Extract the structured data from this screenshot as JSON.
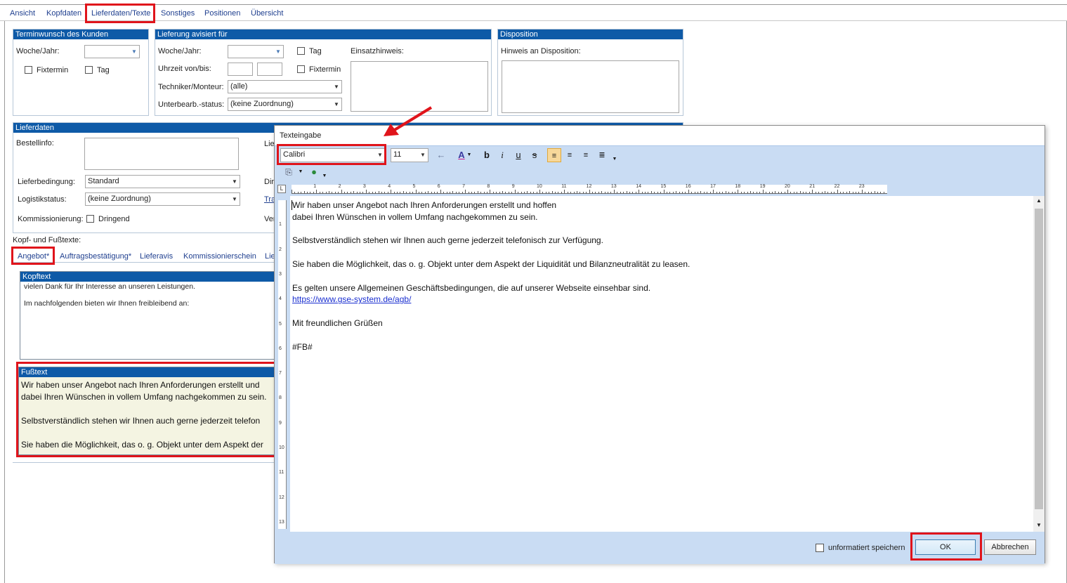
{
  "tabs": [
    "Ansicht",
    "Kopfdaten",
    "Lieferdaten/Texte",
    "Sonstiges",
    "Positionen",
    "Übersicht"
  ],
  "termin": {
    "header": "Terminwunsch des Kunden",
    "woche_label": "Woche/Jahr:",
    "fixtermin": "Fixtermin",
    "tag": "Tag"
  },
  "lieferung": {
    "header": "Lieferung avisiert für",
    "woche_label": "Woche/Jahr:",
    "tag": "Tag",
    "einsatz_label": "Einsatzhinweis:",
    "uhrzeit_label": "Uhrzeit von/bis:",
    "fixtermin": "Fixtermin",
    "techniker_label": "Techniker/Monteur:",
    "techniker_value": "(alle)",
    "unterbearb_label": "Unterbearb.-status:",
    "unterbearb_value": "(keine Zuordnung)"
  },
  "disposition": {
    "header": "Disposition",
    "hinweis_label": "Hinweis an Disposition:"
  },
  "lieferdaten": {
    "header": "Lieferdaten",
    "bestellinfo_label": "Bestellinfo:",
    "lieferbedingung_label": "Lieferbedingung:",
    "lieferbedingung_value": "Standard",
    "logistik_label": "Logistikstatus:",
    "logistik_value": "(keine Zuordnung)",
    "kommission_label": "Kommissionierung:",
    "dringend": "Dringend",
    "right_frag_1": "Lie",
    "right_frag_2": "Dir",
    "right_frag_3": "Tra",
    "right_frag_4": "Ver"
  },
  "kopffuss_label": "Kopf- und Fußtexte:",
  "subtabs": [
    "Angebot*",
    "Auftragsbestätigung*",
    "Lieferavis",
    "Kommissionierschein",
    "Lie"
  ],
  "kopftext": {
    "header": "Kopftext",
    "lines": [
      "vielen Dank für Ihr Interesse an unseren Leistungen.",
      "Im nachfolgenden bieten wir Ihnen freibleibend an:"
    ]
  },
  "fusstext": {
    "header": "Fußtext",
    "lines": [
      "Wir haben unser Angebot nach Ihren Anforderungen erstellt und",
      "dabei Ihren Wünschen in vollem Umfang nachgekommen zu sein.",
      "Selbstverständlich stehen wir Ihnen auch gerne jederzeit telefon",
      "Sie haben die Möglichkeit, das o. g. Objekt unter dem Aspekt der"
    ]
  },
  "dialog": {
    "title": "Texteingabe",
    "font": "Calibri",
    "size": "11",
    "bold": "b",
    "italic": "i",
    "underline": "u",
    "strike": "s",
    "ruler_numbers": [
      "1",
      "2",
      "3",
      "4",
      "5",
      "6",
      "7",
      "8",
      "9",
      "10",
      "11",
      "12",
      "13",
      "14",
      "15",
      "16",
      "17",
      "18",
      "19",
      "20",
      "21",
      "22",
      "23"
    ],
    "vruler_numbers": [
      "1",
      "2",
      "3",
      "4",
      "5",
      "6",
      "7",
      "8",
      "9",
      "10",
      "11",
      "12",
      "13"
    ],
    "text_lines": [
      "Wir haben unser Angebot nach Ihren Anforderungen erstellt und hoffen",
      "dabei Ihren Wünschen in vollem Umfang nachgekommen zu sein.",
      "",
      "Selbstverständlich stehen wir Ihnen auch gerne jederzeit telefonisch zur Verfügung.",
      "",
      "Sie haben die Möglichkeit, das o. g. Objekt unter dem Aspekt der Liquidität und Bilanzneutralität zu leasen.",
      "",
      "Es gelten unsere Allgemeinen Geschäftsbedingungen, die auf unserer Webseite einsehbar sind.",
      "https://www.gse-system.de/agb/",
      "",
      "Mit freundlichen Grüßen",
      "",
      "#FB#"
    ],
    "unformatiert": "unformatiert speichern",
    "ok": "OK",
    "abbrechen": "Abbrechen"
  },
  "colors": {
    "accent": "#0e5aa7",
    "highlight": "#e0141b",
    "toolbar": "#c9dcf3"
  }
}
